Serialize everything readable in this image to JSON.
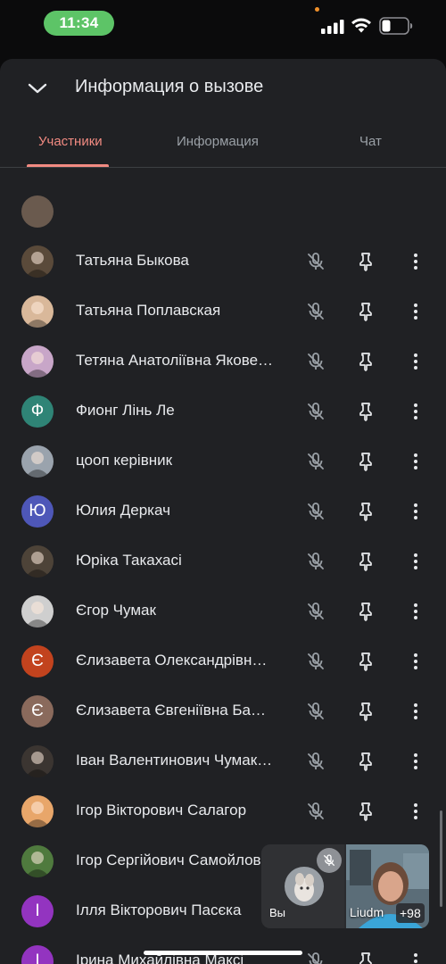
{
  "status_bar": {
    "time": "11:34"
  },
  "header": {
    "title": "Информация о вызове"
  },
  "tabs": [
    {
      "label": "Участники",
      "active": true
    },
    {
      "label": "Информация",
      "active": false
    },
    {
      "label": "Чат",
      "active": false
    }
  ],
  "participants": [
    {
      "name": "Татьяна Быкова",
      "avatar_type": "photo",
      "avatar_color": "#5a4a3a"
    },
    {
      "name": "Татьяна Поплавская",
      "avatar_type": "photo",
      "avatar_color": "#d9b89a"
    },
    {
      "name": "Тетяна Анатоліївна Якове…",
      "avatar_type": "photo",
      "avatar_color": "#c8a6c8"
    },
    {
      "name": "Фионг Лінь Ле",
      "avatar_type": "letter",
      "initial": "Ф",
      "avatar_color": "#2f8476"
    },
    {
      "name": "цооп керівник",
      "avatar_type": "photo",
      "avatar_color": "#9aa3ad"
    },
    {
      "name": "Юлия Деркач",
      "avatar_type": "letter",
      "initial": "Ю",
      "avatar_color": "#4e57b8"
    },
    {
      "name": "Юріка Такахасі",
      "avatar_type": "photo",
      "avatar_color": "#4d4338"
    },
    {
      "name": "Єгор Чумак",
      "avatar_type": "photo",
      "avatar_color": "#cfcfcf"
    },
    {
      "name": "Єлизавета Олександрівн…",
      "avatar_type": "letter",
      "initial": "Є",
      "avatar_color": "#c2431e"
    },
    {
      "name": "Єлизавета Євгеніївна Ба…",
      "avatar_type": "letter",
      "initial": "Є",
      "avatar_color": "#8a6a5c"
    },
    {
      "name": "Іван Валентинович Чумак…",
      "avatar_type": "photo",
      "avatar_color": "#3b3531"
    },
    {
      "name": "Ігор Вікторович Салагор",
      "avatar_type": "photo",
      "avatar_color": "#e8a66a"
    },
    {
      "name": "Ігор Сергійович Самойлов",
      "avatar_type": "photo",
      "avatar_color": "#4f7a3e"
    },
    {
      "name": "Ілля Вікторович Пасєка",
      "avatar_type": "letter",
      "initial": "І",
      "avatar_color": "#9334c0"
    },
    {
      "name": "Ірина Михайлівна Максі",
      "avatar_type": "letter",
      "initial": "І",
      "avatar_color": "#9334c0"
    }
  ],
  "row_icons": {
    "mic": "mic-off-icon",
    "pin": "pin-icon",
    "more": "more-vert-icon"
  },
  "pip": {
    "self_label": "Вы",
    "other_label": "Liudm",
    "others_count": "+98"
  },
  "colors": {
    "accent": "#f28b82",
    "sheet_bg": "#202124",
    "time_pill": "#5dc467"
  }
}
